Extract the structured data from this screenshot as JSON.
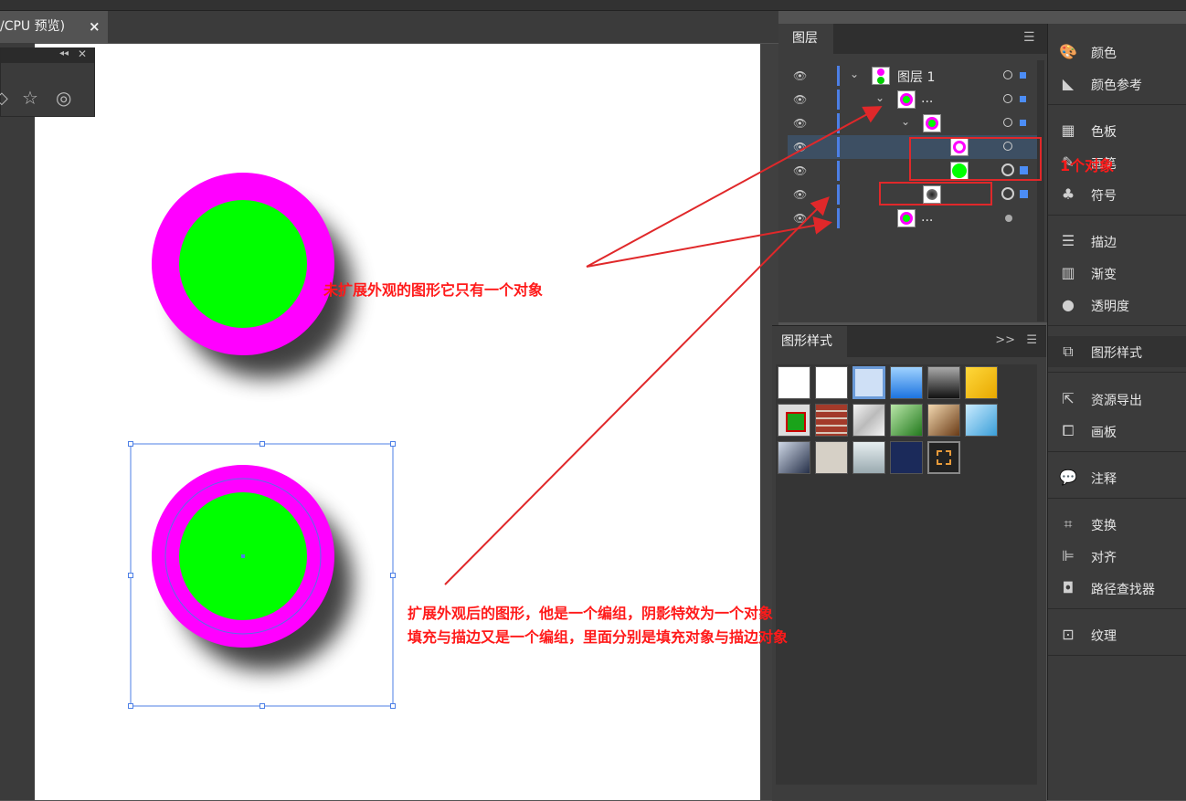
{
  "document_tab": {
    "title": "/CPU 预览)",
    "close": "×"
  },
  "layers_panel": {
    "tab": "图层",
    "layer_name": "图层 1",
    "ellipsis": "..."
  },
  "graphic_styles_panel": {
    "tab": "图形样式",
    "expand": ">>"
  },
  "dock": {
    "items": [
      {
        "label": "颜色",
        "icon": "palette-icon"
      },
      {
        "label": "颜色参考",
        "icon": "color-guide-icon"
      },
      {
        "label": "色板",
        "icon": "swatches-icon"
      },
      {
        "label": "画笔",
        "icon": "brush-icon"
      },
      {
        "label": "符号",
        "icon": "club-icon"
      },
      {
        "label": "描边",
        "icon": "stroke-icon"
      },
      {
        "label": "渐变",
        "icon": "gradient-icon"
      },
      {
        "label": "透明度",
        "icon": "transparency-icon"
      },
      {
        "label": "图形样式",
        "icon": "graphic-styles-icon"
      },
      {
        "label": "资源导出",
        "icon": "export-icon"
      },
      {
        "label": "画板",
        "icon": "artboard-icon"
      },
      {
        "label": "注释",
        "icon": "comment-icon"
      },
      {
        "label": "变换",
        "icon": "transform-icon"
      },
      {
        "label": "对齐",
        "icon": "align-icon"
      },
      {
        "label": "路径查找器",
        "icon": "pathfinder-icon"
      },
      {
        "label": "纹理",
        "icon": "texture-icon"
      }
    ]
  },
  "annotations": {
    "one_object": "1个对象",
    "not_expanded": "未扩展外观的图形它只有一个对象",
    "expanded_line1": "扩展外观后的图形，他是一个编组，阴影特效为一个对象",
    "expanded_line2": "填充与描边又是一个编组，里面分别是填充对象与描边对象"
  },
  "colors": {
    "stroke_ring": "#ff00ff",
    "fill": "#00ff00",
    "annotation": "#ff1a1a",
    "selection": "#4c7fe6"
  }
}
